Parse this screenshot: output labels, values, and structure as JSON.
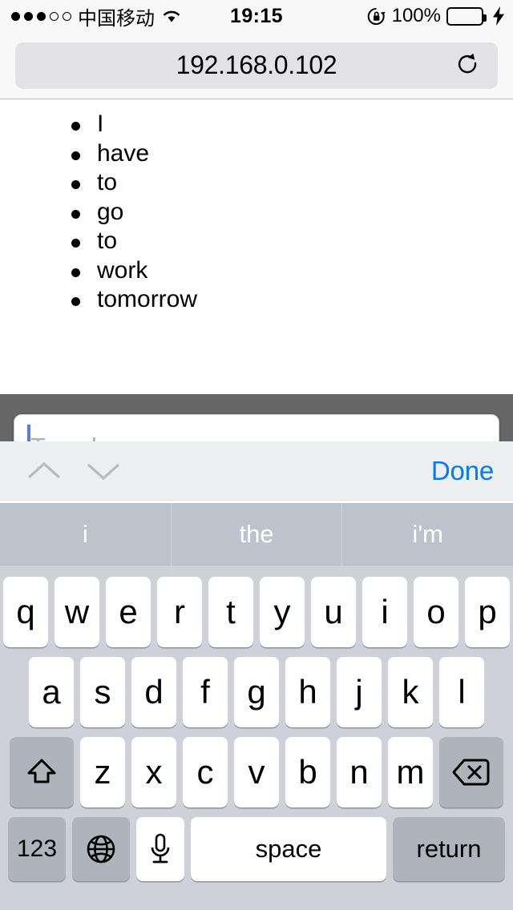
{
  "status_bar": {
    "signal_dots_filled": 3,
    "signal_dots_total": 5,
    "carrier": "中国移动",
    "wifi_icon": "wifi-icon",
    "time": "19:15",
    "rotation_lock_icon": "rotation-lock-icon",
    "battery_percent": "100%",
    "battery_level": 100,
    "charging": true,
    "battery_color": "#4CD964"
  },
  "browser": {
    "url": "192.168.0.102",
    "reload_icon": "reload-icon"
  },
  "page": {
    "list_items": [
      "I",
      "have",
      "to",
      "go",
      "to",
      "work",
      "tomorrow"
    ]
  },
  "form": {
    "input_value": "",
    "input_placeholder": "Type here"
  },
  "accessory_bar": {
    "prev_icon": "chevron-up-icon",
    "next_icon": "chevron-down-icon",
    "done_label": "Done",
    "done_color": "#007AFF"
  },
  "suggestions": [
    "i",
    "the",
    "i'm"
  ],
  "keyboard": {
    "row1": [
      "q",
      "w",
      "e",
      "r",
      "t",
      "y",
      "u",
      "i",
      "o",
      "p"
    ],
    "row2": [
      "a",
      "s",
      "d",
      "f",
      "g",
      "h",
      "j",
      "k",
      "l"
    ],
    "row3": [
      "z",
      "x",
      "c",
      "v",
      "b",
      "n",
      "m"
    ],
    "shift_icon": "shift-icon",
    "backspace_icon": "backspace-icon",
    "numbers_label": "123",
    "globe_icon": "globe-icon",
    "mic_icon": "microphone-icon",
    "space_label": "space",
    "return_label": "return"
  }
}
